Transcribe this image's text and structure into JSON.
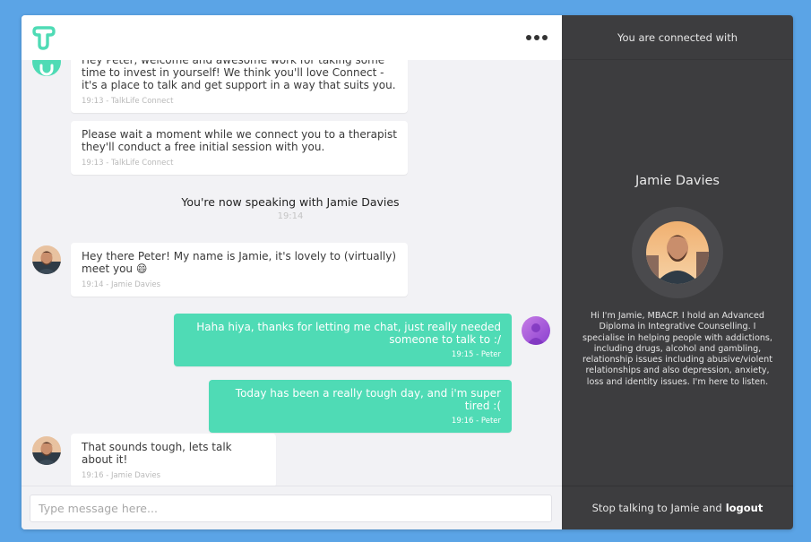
{
  "app": {
    "brand_color": "#4fdbb5",
    "background_color": "#5ba4e6"
  },
  "header": {
    "logo_icon": "talklife-logo-icon",
    "menu_icon": "more-dots-icon"
  },
  "messages": [
    {
      "text": "Hey Peter, welcome and awesome work for taking some time to invest in yourself! We think you'll love Connect - it's a place to talk and get support in a way that suits you.",
      "meta": "19:13 - TalkLife Connect"
    },
    {
      "text": "Please wait a moment while we connect you to a therapist they'll conduct a free initial session with you.",
      "meta": "19:13 - TalkLife Connect"
    },
    {
      "text": "Hey there Peter! My name is Jamie, it's lovely to (virtually) meet you 😄",
      "meta": "19:14 - Jamie Davies"
    },
    {
      "text": "Haha hiya, thanks for letting me chat, just really needed someone to talk to :/",
      "meta": "19:15 - Peter"
    },
    {
      "text": "Today has been a really tough day, and i'm super tired :(",
      "meta": "19:16 - Peter"
    },
    {
      "text": "That sounds tough, lets talk about it!",
      "meta": "19:16 - Jamie Davies"
    }
  ],
  "system_note": {
    "text": "You're now speaking with Jamie Davies",
    "time": "19:14"
  },
  "composer": {
    "placeholder": "Type message here..."
  },
  "sidebar": {
    "header": "You are connected with",
    "therapist_name": "Jamie Davies",
    "bio": "Hi I'm Jamie, MBACP. I hold an Advanced Diploma in Integrative Counselling. I specialise in helping people with addictions, including drugs, alcohol and gambling, relationship issues including abusive/violent relationships and also depression, anxiety, loss and identity issues. I'm here to listen.",
    "footer_text": "Stop talking to Jamie and",
    "footer_link": "logout"
  }
}
